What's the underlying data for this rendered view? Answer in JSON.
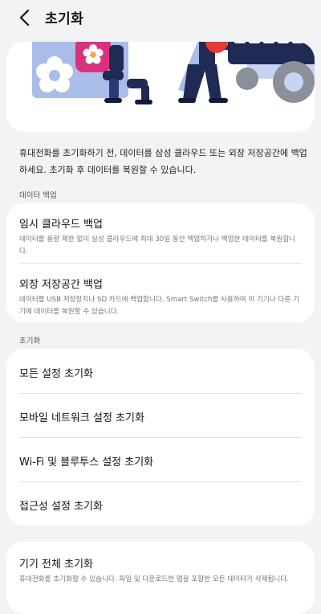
{
  "header": {
    "title": "초기화"
  },
  "description": "휴대전화를 초기화하기 전, 데이터를 삼성 클라우드 또는 외장 저장공간에 백업하세요. 초기화 후 데이터를 복원할 수 있습니다.",
  "backup_section": {
    "label": "데이터 백업",
    "items": [
      {
        "title": "임시 클라우드 백업",
        "subtitle": "데이터를 용량 제한 없이 삼성 클라우드에 최대 30일 동안 백업하거나 백업한 데이터를 복원합니다."
      },
      {
        "title": "외장 저장공간 백업",
        "subtitle": "데이터를 USB 저장장치나 SD 카드에 백업합니다. Smart Switch를 사용하여 이 기기나 다른 기기에 데이터를 복원할 수 있습니다."
      }
    ]
  },
  "reset_section": {
    "label": "초기화",
    "items": [
      {
        "title": "모든 설정 초기화"
      },
      {
        "title": "모바일 네트워크 설정 초기화"
      },
      {
        "title": "Wi-Fi 및 블루투스 설정 초기화"
      },
      {
        "title": "접근성 설정 초기화"
      }
    ]
  },
  "factory_reset": {
    "title": "기기 전체 초기화",
    "subtitle": "휴대전화를 초기화할 수 있습니다. 파일 및 다운로드한 앱을 포함한 모든 데이터가 삭제됩니다."
  },
  "colors": {
    "background": "#f3f3f5",
    "card": "#ffffff",
    "illustration_blue": "#9fb3e6",
    "illustration_navy": "#1f2b55",
    "illustration_pink": "#d8327f",
    "illustration_gray": "#8a8f99"
  }
}
